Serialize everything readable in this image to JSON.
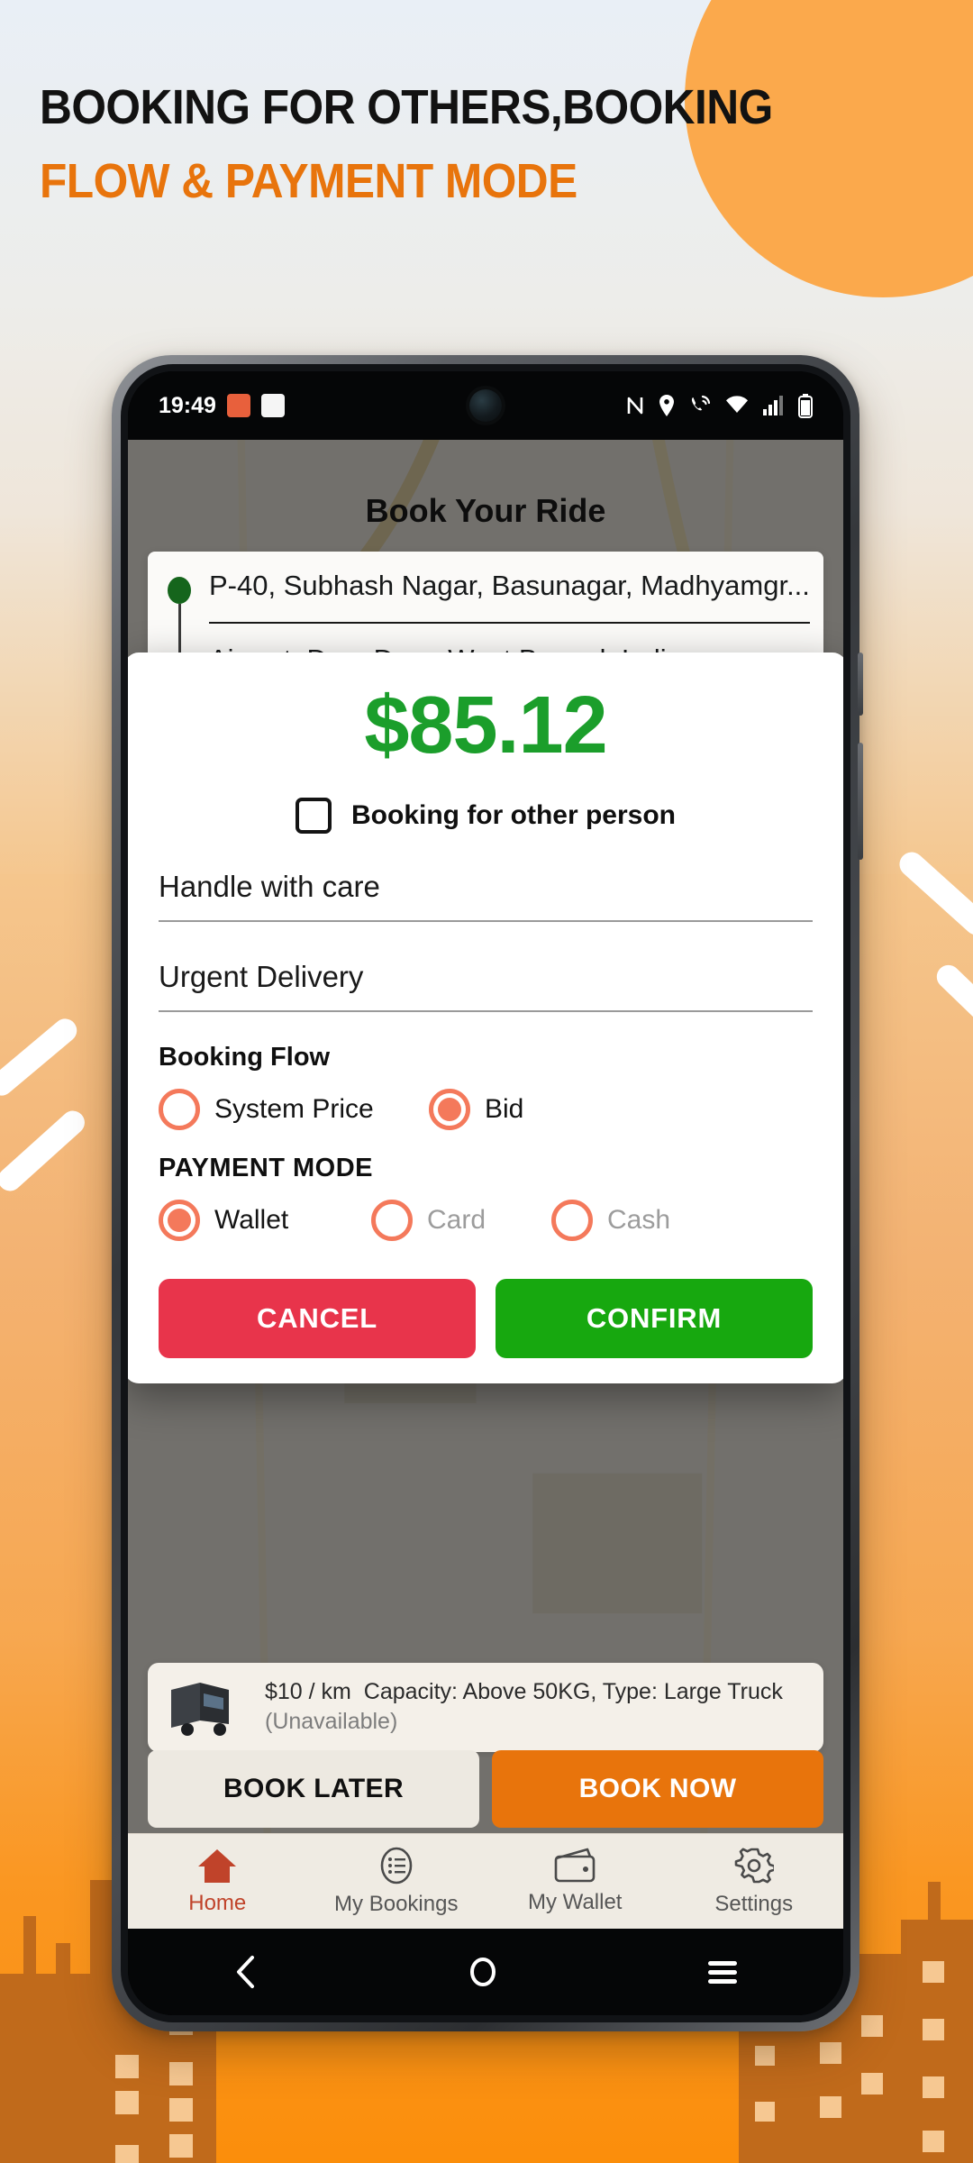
{
  "promo": {
    "headline_line1": "BOOKING FOR OTHERS,BOOKING",
    "headline_line2": "FLOW & PAYMENT MODE",
    "accent_orange": "#E8740C",
    "bg_orange": "#FA9722",
    "circle_orange": "#FBA94C"
  },
  "statusbar": {
    "time": "19:49",
    "icons": [
      "app-icon-red",
      "app-icon-white",
      "nfc-icon",
      "location-icon",
      "call-mute-icon",
      "wifi-icon",
      "signal-icon",
      "battery-icon"
    ]
  },
  "app": {
    "screen_title": "Book Your Ride",
    "pickup": "P-40, Subhash Nagar, Basunagar, Madhyamgr...",
    "dropoff": "Airport, Dum Dum, West Bengal, India",
    "vehicle": {
      "rate": "$10 / km",
      "details": "Capacity: Above 50KG, Type: Large Truck",
      "status": "(Unavailable)"
    },
    "book_later": "BOOK LATER",
    "book_now": "BOOK NOW",
    "tabs": [
      {
        "label": "Home",
        "icon": "home-icon",
        "active": true
      },
      {
        "label": "My Bookings",
        "icon": "list-icon",
        "active": false
      },
      {
        "label": "My Wallet",
        "icon": "wallet-icon",
        "active": false
      },
      {
        "label": "Settings",
        "icon": "gear-icon",
        "active": false
      }
    ]
  },
  "dialog": {
    "price": "$85.12",
    "price_color": "#1B9E2B",
    "checkbox_label": "Booking for other person",
    "checkbox_checked": false,
    "fields": [
      {
        "name": "handle-note",
        "value": "Handle with care"
      },
      {
        "name": "urgency-note",
        "value": "Urgent Delivery"
      }
    ],
    "booking_flow": {
      "title": "Booking Flow",
      "options": [
        {
          "label": "System Price",
          "selected": false,
          "disabled": false
        },
        {
          "label": "Bid",
          "selected": true,
          "disabled": false
        }
      ]
    },
    "payment_mode": {
      "title": "PAYMENT MODE",
      "options": [
        {
          "label": "Wallet",
          "selected": true,
          "disabled": false
        },
        {
          "label": "Card",
          "selected": false,
          "disabled": true
        },
        {
          "label": "Cash",
          "selected": false,
          "disabled": true
        }
      ]
    },
    "cancel_label": "CANCEL",
    "confirm_label": "CONFIRM",
    "cancel_color": "#E8344B",
    "confirm_color": "#17A80F",
    "radio_color": "#F4795B"
  },
  "navbar": {
    "buttons": [
      "back-icon",
      "home-circle-icon",
      "recents-icon"
    ]
  }
}
